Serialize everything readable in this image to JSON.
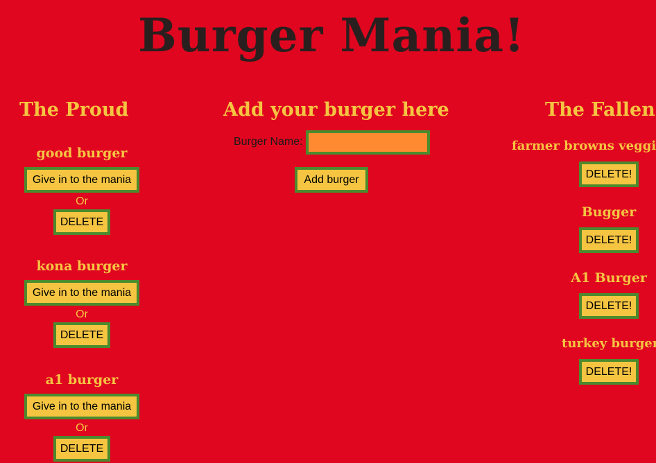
{
  "title": "Burger Mania!",
  "proud": {
    "heading": "The Proud",
    "give_label": "Give in to the mania",
    "or_label": "Or",
    "delete_label": "DELETE",
    "items": [
      {
        "name": "good burger"
      },
      {
        "name": "kona burger"
      },
      {
        "name": "a1 burger"
      }
    ]
  },
  "form": {
    "heading": "Add your burger here",
    "label": "Burger Name:",
    "input_value": "",
    "input_placeholder": "",
    "submit_label": "Add burger"
  },
  "fallen": {
    "heading": "The Fallen",
    "delete_label": "DELETE!",
    "items": [
      {
        "name": "farmer browns veggie"
      },
      {
        "name": "Bugger"
      },
      {
        "name": "A1 Burger"
      },
      {
        "name": "turkey burger"
      }
    ]
  },
  "colors": {
    "background": "#e0061f",
    "accent_text": "#f5c542",
    "button_fill": "#f5c542",
    "button_border": "#4c8a2e",
    "input_fill": "#ff8a30",
    "title_text": "#2a1f1f"
  }
}
